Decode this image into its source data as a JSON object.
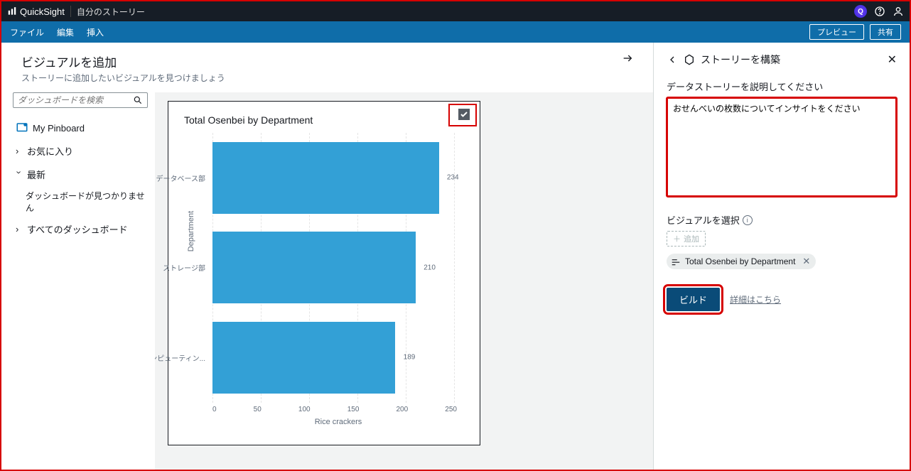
{
  "titlebar": {
    "product": "QuickSight",
    "breadcrumb": "自分のストーリー"
  },
  "menubar": {
    "items": [
      "ファイル",
      "編集",
      "挿入"
    ],
    "preview": "プレビュー",
    "share": "共有"
  },
  "addVisual": {
    "title": "ビジュアルを追加",
    "subtitle": "ストーリーに追加したいビジュアルを見つけましょう"
  },
  "sidebar": {
    "searchPlaceholder": "ダッシュボードを検索",
    "pinboard": "My Pinboard",
    "favorites": "お気に入り",
    "recent": "最新",
    "notFound": "ダッシュボードが見つかりません",
    "allDashboards": "すべてのダッシュボード"
  },
  "chart_data": {
    "type": "bar",
    "orientation": "horizontal",
    "title": "Total Osenbei by Department",
    "ylabel": "Department",
    "xlabel": "Rice crackers",
    "xlim": [
      0,
      260
    ],
    "xticks": [
      0,
      50,
      100,
      150,
      200,
      250
    ],
    "categories": [
      "データベース部",
      "ストレージ部",
      "コンピューティン..."
    ],
    "values": [
      234,
      210,
      189
    ]
  },
  "rightPanel": {
    "title": "ストーリーを構築",
    "describeLabel": "データストーリーを説明してください",
    "describeValue": "おせんべいの枚数についてインサイトをください",
    "selectVisualLabel": "ビジュアルを選択",
    "addLabel": "追加",
    "chipLabel": "Total Osenbei by Department",
    "buildLabel": "ビルド",
    "detailsLink": "詳細はこちら"
  }
}
